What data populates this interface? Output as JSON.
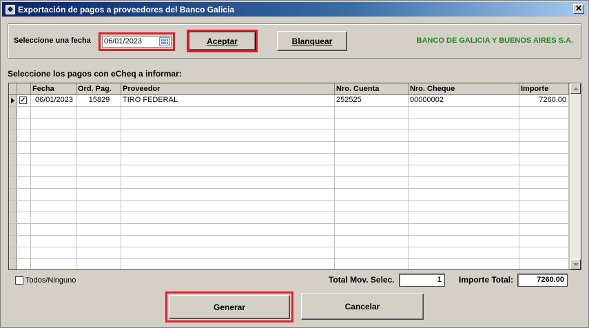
{
  "window": {
    "title": "Exportación de pagos a proveedores del Banco Galicia",
    "close_glyph": "✕"
  },
  "filter": {
    "date_label": "Seleccione una fecha",
    "date_value": "06/01/2023",
    "accept_label": "Aceptar",
    "clear_label": "Blanquear",
    "bank_name": "BANCO DE GALICIA Y BUENOS AIRES  S.A."
  },
  "section_title": "Seleccione los pagos con eCheq a informar:",
  "table": {
    "columns": [
      "Fecha",
      "Ord. Pag.",
      "Proveedor",
      "Nro. Cuenta",
      "Nro. Cheque",
      "Importe"
    ],
    "rows": [
      {
        "checked": true,
        "current": true,
        "fecha": "06/01/2023",
        "ord_pag": "15829",
        "proveedor": "TIRO FEDERAL",
        "nro_cuenta": "252525",
        "nro_cheque": "00000002",
        "importe": "7260.00"
      }
    ]
  },
  "footer": {
    "select_all_label": "Todos/Ninguno",
    "total_mov_label": "Total Mov. Selec.",
    "total_mov_value": "1",
    "total_importe_label": "Importe Total:",
    "total_importe_value": "7260.00",
    "generate_label": "Generar",
    "cancel_label": "Cancelar"
  },
  "colors": {
    "highlight_frame": "#e0202a",
    "bank_text": "#1f8a1f",
    "title_bar": "#0a246a"
  }
}
